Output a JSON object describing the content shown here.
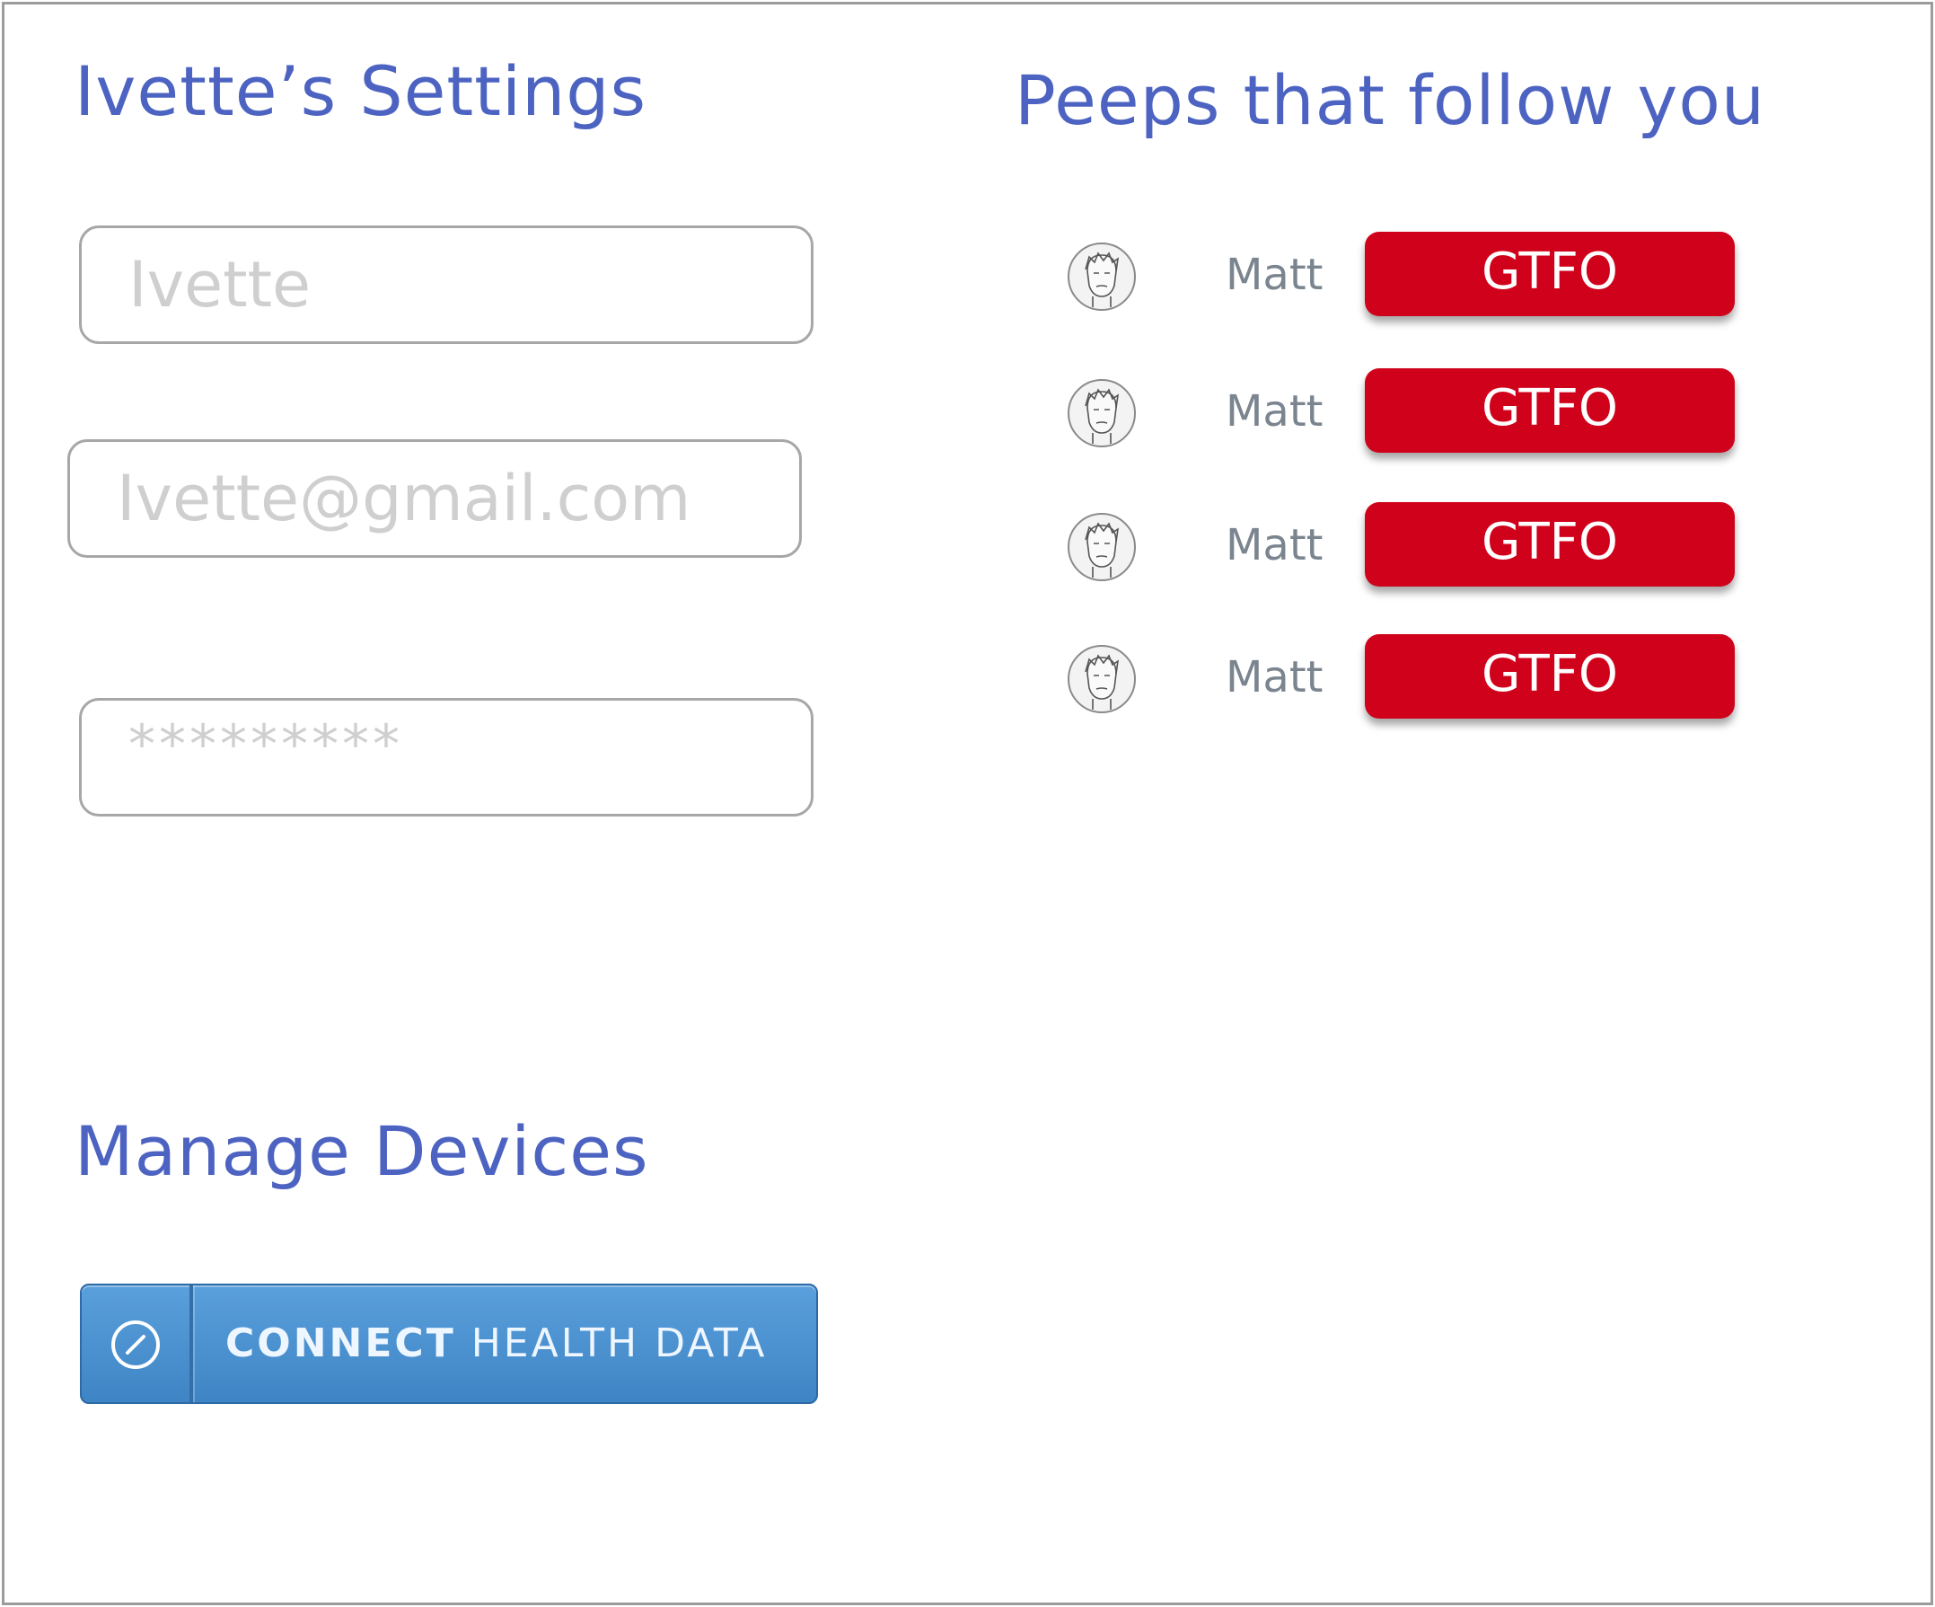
{
  "settings": {
    "title": "Ivette’s Settings",
    "name_field": {
      "placeholder": "Ivette"
    },
    "email_field": {
      "placeholder": "Ivette@gmail.com"
    },
    "password_field": {
      "placeholder": "*********"
    }
  },
  "followers": {
    "title": "Peeps that follow you",
    "items": [
      {
        "name": "Matt",
        "action_label": "GTFO"
      },
      {
        "name": "Matt",
        "action_label": "GTFO"
      },
      {
        "name": "Matt",
        "action_label": "GTFO"
      },
      {
        "name": "Matt",
        "action_label": "GTFO"
      }
    ]
  },
  "devices": {
    "title": "Manage Devices",
    "connect_button": {
      "label_strong": "CONNECT",
      "label_rest": " HEALTH DATA",
      "icon": "compass-slash-icon"
    }
  },
  "colors": {
    "heading": "#4d63c2",
    "gtfo_button": "#d0021b",
    "connect_button": "#4a90d2"
  }
}
